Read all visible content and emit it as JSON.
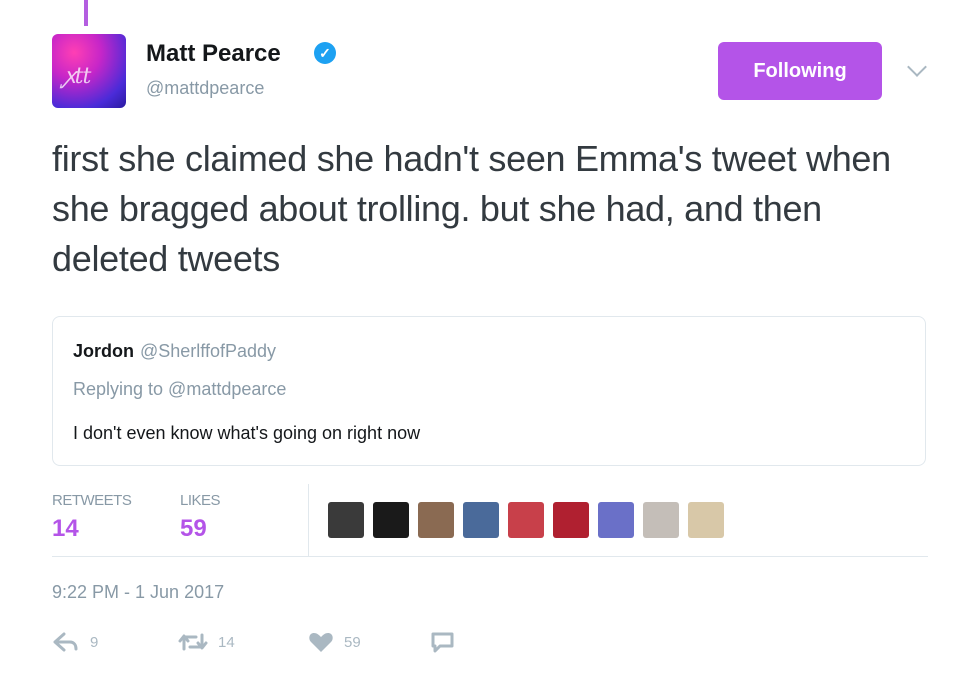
{
  "tweet": {
    "author": {
      "name": "Matt Pearce",
      "handle": "@mattdpearce",
      "verified": true,
      "avatar_icon": "avatar-photo"
    },
    "follow_button_label": "Following",
    "text": "first she claimed she hadn't seen Emma's tweet when she bragged about trolling. but she had, and then deleted tweets",
    "quoted": {
      "author_name": "Jordon",
      "author_handle": "@SherlffofPaddy",
      "replying_to": "Replying to @mattdpearce",
      "text": "I don't even know what's going on right now"
    },
    "stats": {
      "retweets_label": "RETWEETS",
      "retweets_count": "14",
      "likes_label": "LIKES",
      "likes_count": "59"
    },
    "likers": [
      {
        "color": "#3a3a3a"
      },
      {
        "color": "#1a1a1a"
      },
      {
        "color": "#8a6a52"
      },
      {
        "color": "#4a6a9a"
      },
      {
        "color": "#c8404a"
      },
      {
        "color": "#b02030"
      },
      {
        "color": "#6a70c8"
      },
      {
        "color": "#c4beb8"
      },
      {
        "color": "#d8c8a8"
      }
    ],
    "timestamp": "9:22 PM - 1 Jun 2017",
    "actions": {
      "reply_count": "9",
      "retweet_count": "14",
      "like_count": "59"
    },
    "accent_color": "#b454e8"
  }
}
